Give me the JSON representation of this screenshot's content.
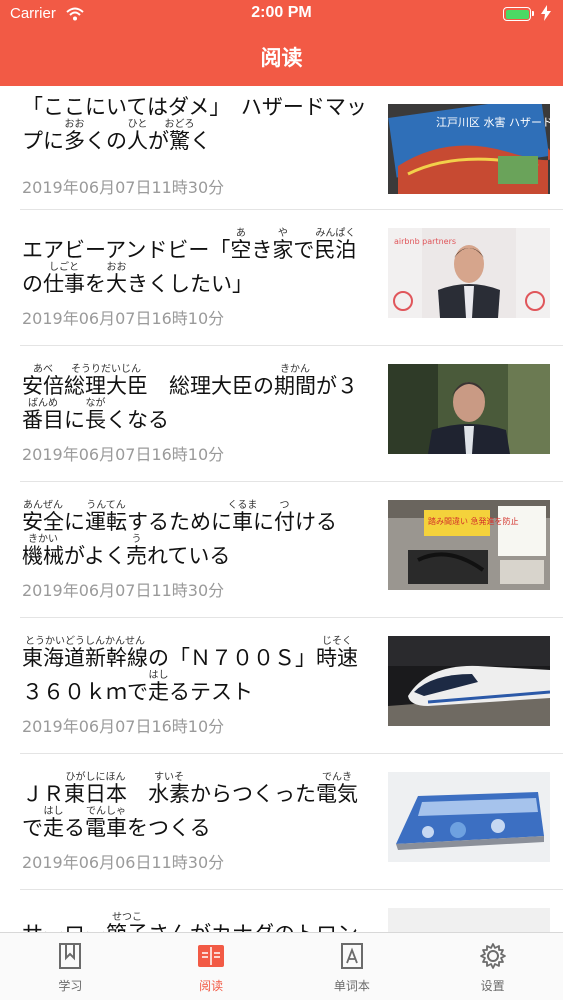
{
  "status_bar": {
    "carrier": "Carrier",
    "time": "2:00 PM",
    "battery_level": 1.0
  },
  "nav": {
    "title": "阅读"
  },
  "articles": [
    {
      "title_parts": [
        {
          "t": "「ここにいてはダメ」　ハザードマップに"
        },
        {
          "t": "多",
          "r": "おお"
        },
        {
          "t": "くの"
        },
        {
          "t": "人",
          "r": "ひと"
        },
        {
          "t": "が"
        },
        {
          "t": "驚",
          "r": "おどろ"
        },
        {
          "t": "く"
        }
      ],
      "date": "2019年06月07日11時30分",
      "thumb_text": "江戸川区 水害 ハザードマップ"
    },
    {
      "title_parts": [
        {
          "t": "エアビーアンドビー「"
        },
        {
          "t": "空",
          "r": "あ"
        },
        {
          "t": "き"
        },
        {
          "t": "家",
          "r": "や"
        },
        {
          "t": "で"
        },
        {
          "t": "民泊",
          "r": "みんぱく"
        },
        {
          "t": "の"
        },
        {
          "t": "仕事",
          "r": "しごと"
        },
        {
          "t": "を"
        },
        {
          "t": "大",
          "r": "おお"
        },
        {
          "t": "きくしたい」"
        }
      ],
      "date": "2019年06月07日16時10分",
      "thumb_text": "airbnb partners"
    },
    {
      "title_parts": [
        {
          "t": "安倍",
          "r": "あべ"
        },
        {
          "t": "総理大臣",
          "r": "そうりだいじん"
        },
        {
          "t": "　総理大臣の"
        },
        {
          "t": "期間",
          "r": "きかん"
        },
        {
          "t": "が３"
        },
        {
          "t": "番目",
          "r": "ばんめ"
        },
        {
          "t": "に"
        },
        {
          "t": "長",
          "r": "なが"
        },
        {
          "t": "くなる"
        }
      ],
      "date": "2019年06月07日16時10分",
      "thumb_text": ""
    },
    {
      "title_parts": [
        {
          "t": "安全",
          "r": "あんぜん"
        },
        {
          "t": "に"
        },
        {
          "t": "運転",
          "r": "うんてん"
        },
        {
          "t": "するために"
        },
        {
          "t": "車",
          "r": "くるま"
        },
        {
          "t": "に"
        },
        {
          "t": "付",
          "r": "つ"
        },
        {
          "t": "ける"
        },
        {
          "t": "機械",
          "r": "きかい"
        },
        {
          "t": "がよく"
        },
        {
          "t": "売",
          "r": "う"
        },
        {
          "t": "れている"
        }
      ],
      "date": "2019年06月07日11時30分",
      "thumb_text": "踏み間違い 急発進を防止"
    },
    {
      "title_parts": [
        {
          "t": "東海道新幹線",
          "r": "とうかいどうしんかんせん"
        },
        {
          "t": "の「Ｎ７００Ｓ」"
        },
        {
          "t": "時速",
          "r": "じそく"
        },
        {
          "t": "３６０ｋｍで"
        },
        {
          "t": "走",
          "r": "はし"
        },
        {
          "t": "るテスト"
        }
      ],
      "date": "2019年06月07日16時10分",
      "thumb_text": ""
    },
    {
      "title_parts": [
        {
          "t": "ＪＲ"
        },
        {
          "t": "東日本",
          "r": "ひがしにほん"
        },
        {
          "t": "　"
        },
        {
          "t": "水素",
          "r": "すいそ"
        },
        {
          "t": "からつくった"
        },
        {
          "t": "電気",
          "r": "でんき"
        },
        {
          "t": "で"
        },
        {
          "t": "走",
          "r": "はし"
        },
        {
          "t": "る"
        },
        {
          "t": "電車",
          "r": "でんしゃ"
        },
        {
          "t": "をつくる"
        }
      ],
      "date": "2019年06月06日11時30分",
      "thumb_text": ""
    },
    {
      "title_parts": [
        {
          "t": "サーロー"
        },
        {
          "t": "節子",
          "r": "せつこ"
        },
        {
          "t": "さんがカナダのトロン"
        }
      ],
      "date": "",
      "thumb_text": ""
    }
  ],
  "tabbar": {
    "tabs": [
      {
        "label": "学习",
        "icon": "book-icon"
      },
      {
        "label": "阅读",
        "icon": "reading-icon"
      },
      {
        "label": "单词本",
        "icon": "vocabulary-icon"
      },
      {
        "label": "设置",
        "icon": "gear-icon"
      }
    ],
    "active_index": 1
  },
  "colors": {
    "accent": "#f25a45",
    "date": "#9a9a9a",
    "tab_inactive": "#6b6b6b"
  }
}
